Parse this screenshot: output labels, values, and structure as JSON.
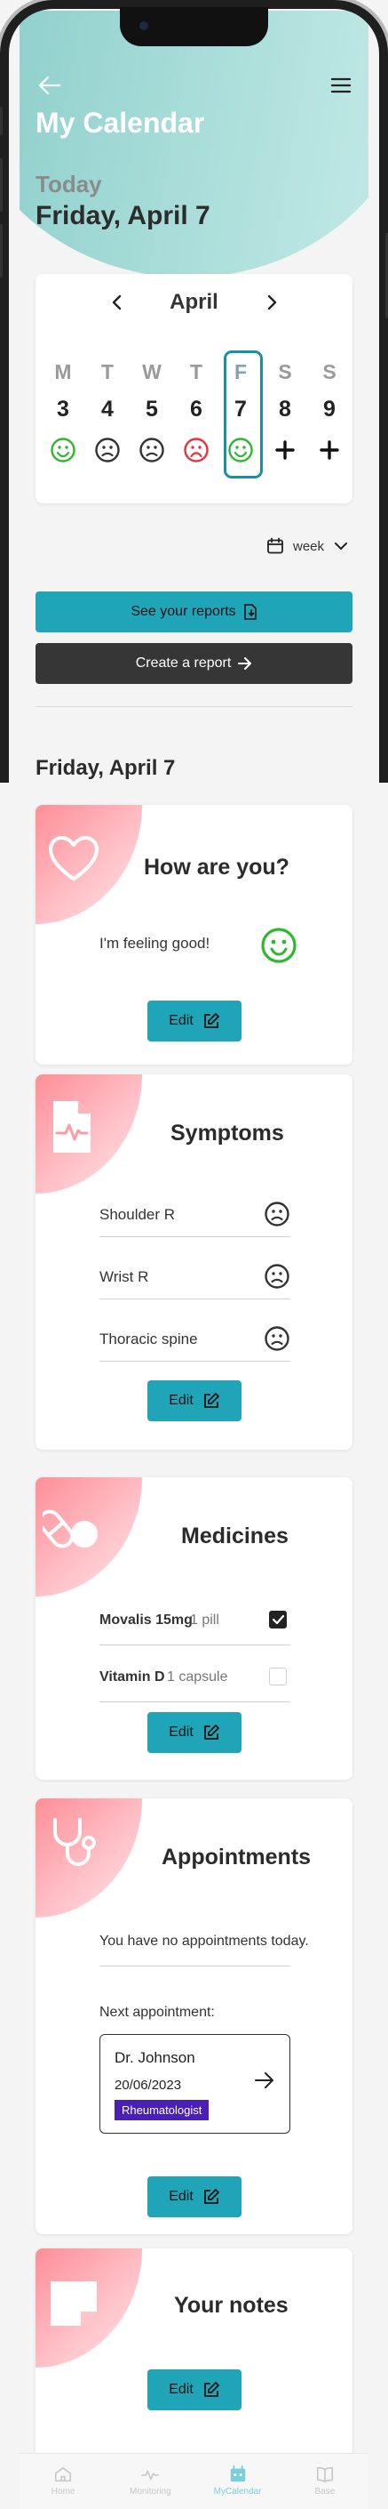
{
  "header": {
    "title": "My Calendar",
    "today_label": "Today",
    "date": "Friday, April 7"
  },
  "calendar": {
    "month": "April",
    "days": [
      {
        "name": "M",
        "date": "3",
        "mood": "happy",
        "mood_color": "#2eb82e"
      },
      {
        "name": "T",
        "date": "4",
        "mood": "neutral",
        "mood_color": "#333333"
      },
      {
        "name": "W",
        "date": "5",
        "mood": "neutral",
        "mood_color": "#333333"
      },
      {
        "name": "T",
        "date": "6",
        "mood": "sad",
        "mood_color": "#e8323c"
      },
      {
        "name": "F",
        "date": "7",
        "mood": "happy",
        "mood_color": "#2eb82e",
        "selected": true
      },
      {
        "name": "S",
        "date": "8",
        "mood": "plus-icon",
        "mood_color": "#111111"
      },
      {
        "name": "S",
        "date": "9",
        "mood": "plus-icon",
        "mood_color": "#111111"
      }
    ],
    "view_selector": "week"
  },
  "actions": {
    "reports_label": "See your reports",
    "create_report_label": "Create a report"
  },
  "section_date": "Friday, April 7",
  "mood_card": {
    "title": "How are you?",
    "status": "I'm feeling good!",
    "edit_label": "Edit"
  },
  "symptoms_card": {
    "title": "Symptoms",
    "items": [
      "Shoulder R",
      "Wrist R",
      "Thoracic spine"
    ],
    "edit_label": "Edit"
  },
  "medicines_card": {
    "title": "Medicines",
    "items": [
      {
        "name": "Movalis 15mg",
        "qty": "1 pill",
        "checked": true
      },
      {
        "name": "Vitamin D",
        "qty": "1 capsule",
        "checked": false
      }
    ],
    "edit_label": "Edit"
  },
  "appointments_card": {
    "title": "Appointments",
    "empty_text": "You have no appointments today.",
    "next_label": "Next appointment:",
    "next": {
      "doctor": "Dr. Johnson",
      "date": "20/06/2023",
      "specialty": "Rheumatologist"
    },
    "edit_label": "Edit"
  },
  "notes_card": {
    "title": "Your notes",
    "edit_label": "Edit"
  },
  "tabbar": {
    "items": [
      {
        "label": "Home",
        "icon": "home-icon"
      },
      {
        "label": "Monitoring",
        "icon": "pulse-icon"
      },
      {
        "label": "MyCalendar",
        "icon": "calendar-icon",
        "active": true
      },
      {
        "label": "Base",
        "icon": "book-icon"
      }
    ]
  },
  "colors": {
    "accent": "#1fa4b8",
    "dark_button": "#363636",
    "hero": "#a7dcd8",
    "card_corner": "#ff9aa4",
    "tag": "#4a1fb8"
  }
}
